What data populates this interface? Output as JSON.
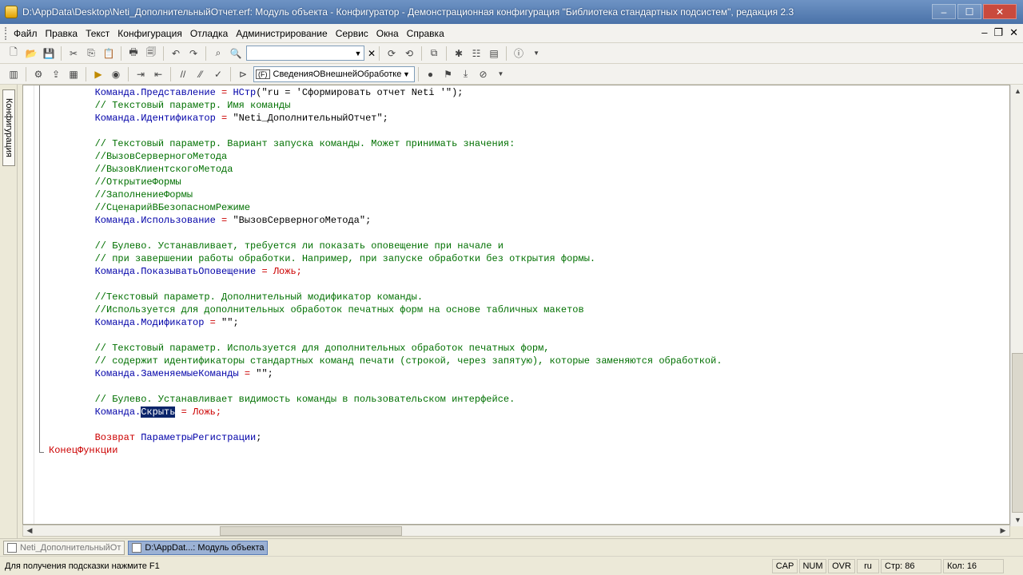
{
  "window": {
    "title": "D:\\AppData\\Desktop\\Neti_ДополнительныйОтчет.erf: Модуль объекта - Конфигуратор - Демонстрационная конфигурация \"Библиотека стандартных подсистем\", редакция 2.3",
    "minimize": "–",
    "maximize": "☐",
    "close": "✕"
  },
  "menu": {
    "items": [
      "Файл",
      "Правка",
      "Текст",
      "Конфигурация",
      "Отладка",
      "Администрирование",
      "Сервис",
      "Окна",
      "Справка"
    ],
    "mdi_minimize": "–",
    "mdi_restore": "❐",
    "mdi_close": "✕"
  },
  "toolbar2": {
    "procedure_badge": "(F)",
    "procedure_value": "СведенияОВнешнейОбработке"
  },
  "side_panel": {
    "tab_label": "Конфигурация"
  },
  "editor": {
    "lines": [
      [
        {
          "t": "Команда.Представление",
          "c": "id"
        },
        {
          "t": " = ",
          "c": "op"
        },
        {
          "t": "НСтр",
          "c": "id"
        },
        {
          "t": "(\"ru = 'Сформировать отчет Neti '\");",
          "c": "str"
        }
      ],
      [
        {
          "t": "// Текстовый параметр. Имя команды",
          "c": "cm"
        }
      ],
      [
        {
          "t": "Команда.Идентификатор",
          "c": "id"
        },
        {
          "t": " = ",
          "c": "op"
        },
        {
          "t": "\"Neti_ДополнительныйОтчет\";",
          "c": "str"
        }
      ],
      [],
      [
        {
          "t": "// Текстовый параметр. Вариант запуска команды. Может принимать значения:",
          "c": "cm"
        }
      ],
      [
        {
          "t": "//ВызовСерверногоМетода",
          "c": "cm"
        }
      ],
      [
        {
          "t": "//ВызовКлиентскогоМетода",
          "c": "cm"
        }
      ],
      [
        {
          "t": "//ОткрытиеФормы",
          "c": "cm"
        }
      ],
      [
        {
          "t": "//ЗаполнениеФормы",
          "c": "cm"
        }
      ],
      [
        {
          "t": "//СценарийВБезопасномРежиме",
          "c": "cm"
        }
      ],
      [
        {
          "t": "Команда.Использование",
          "c": "id"
        },
        {
          "t": " = ",
          "c": "op"
        },
        {
          "t": "\"ВызовСерверногоМетода\";",
          "c": "str"
        }
      ],
      [],
      [
        {
          "t": "// Булево. Устанавливает, требуется ли показать оповещение при начале и",
          "c": "cm"
        }
      ],
      [
        {
          "t": "// при завершении работы обработки. Например, при запуске обработки без открытия формы.",
          "c": "cm"
        }
      ],
      [
        {
          "t": "Команда.ПоказыватьОповещение",
          "c": "id"
        },
        {
          "t": " = Ложь;",
          "c": "op"
        }
      ],
      [],
      [
        {
          "t": "//Текстовый параметр. Дополнительный модификатор команды.",
          "c": "cm"
        }
      ],
      [
        {
          "t": "//Используется для дополнительных обработок печатных форм на основе табличных макетов",
          "c": "cm"
        }
      ],
      [
        {
          "t": "Команда.Модификатор",
          "c": "id"
        },
        {
          "t": " = ",
          "c": "op"
        },
        {
          "t": "\"\";",
          "c": "str"
        }
      ],
      [],
      [
        {
          "t": "// Текстовый параметр. Используется для дополнительных обработок печатных форм,",
          "c": "cm"
        }
      ],
      [
        {
          "t": "// содержит идентификаторы стандартных команд печати (строкой, через запятую), которые заменяются обработкой.",
          "c": "cm"
        }
      ],
      [
        {
          "t": "Команда.ЗаменяемыеКоманды",
          "c": "id"
        },
        {
          "t": " = ",
          "c": "op"
        },
        {
          "t": "\"\";",
          "c": "str"
        }
      ],
      [],
      [
        {
          "t": "// Булево. Устанавливает видимость команды в пользовательском интерфейсе.",
          "c": "cm"
        }
      ],
      [
        {
          "t": "Команда.",
          "c": "id"
        },
        {
          "t": "Скрыть",
          "c": "sel"
        },
        {
          "t": " = Ложь;",
          "c": "op"
        }
      ],
      [],
      [
        {
          "t": "Возврат ",
          "c": "kw"
        },
        {
          "t": "ПараметрыРегистрации",
          "c": "id"
        },
        {
          "t": ";",
          "c": "p"
        }
      ],
      [
        {
          "t": "КонецФункции",
          "c": "kw",
          "outdent": true
        }
      ]
    ]
  },
  "window_tabs": [
    {
      "label": "Neti_ДополнительныйОт",
      "state": "inactive"
    },
    {
      "label": "D:\\AppDat...: Модуль объекта",
      "state": "active"
    }
  ],
  "statusbar": {
    "hint": "Для получения подсказки нажмите F1",
    "cap": "CAP",
    "num": "NUM",
    "ovr": "OVR",
    "lang": "ru",
    "line": "Стр: 86",
    "col": "Кол: 16"
  }
}
